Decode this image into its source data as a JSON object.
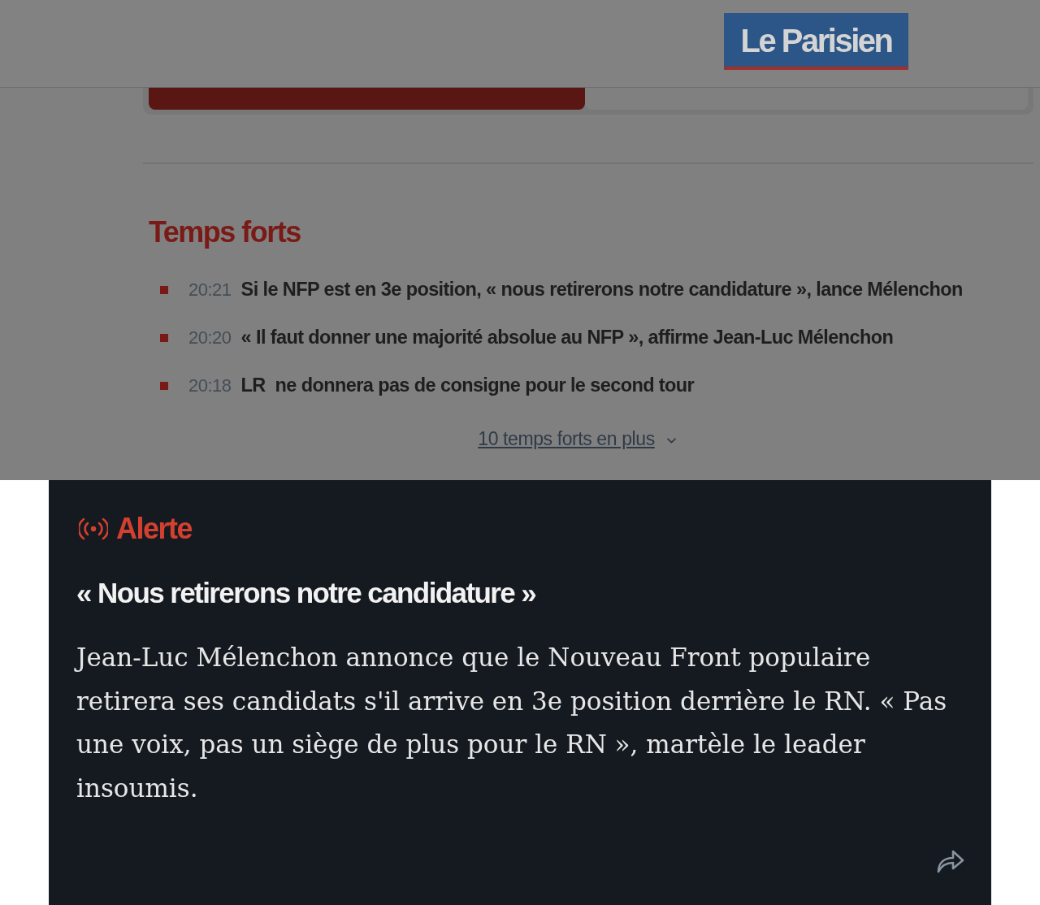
{
  "header": {
    "logo": "Le Parisien"
  },
  "tabs": [
    {
      "selected": true
    },
    {
      "selected": false
    }
  ],
  "highlights": {
    "title": "Temps forts",
    "items": [
      {
        "time": "20:21",
        "title": "Si le NFP est en 3e position, « nous retirerons notre candidature », lance Mélenchon"
      },
      {
        "time": "20:20",
        "title": "« Il faut donner une majorité absolue au NFP », affirme Jean-Luc Mélenchon"
      },
      {
        "time": "20:18",
        "title": "LR  ne donnera pas de consigne pour le second tour"
      }
    ],
    "more_link": "10 temps forts en plus"
  },
  "alert": {
    "label": "Alerte",
    "title": "« Nous retirerons notre candidature »",
    "text": "Jean-Luc Mélenchon annonce que le Nouveau Front populaire retirera ses candidats s'il arrive en 3e position derrière le RN. « Pas une voix, pas un siège de plus pour le RN », martèle le leader insoumis."
  }
}
